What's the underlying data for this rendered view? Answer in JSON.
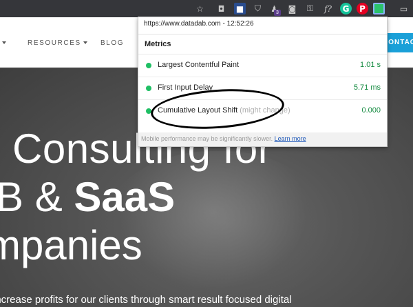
{
  "browser": {
    "extensions": [
      {
        "icon": "star-icon",
        "glyph": "☆"
      },
      {
        "icon": "pocket-icon",
        "glyph": "◘"
      },
      {
        "icon": "adblock-icon",
        "glyph": "■"
      },
      {
        "icon": "shield-icon",
        "glyph": "⛉"
      },
      {
        "icon": "puzzle-icon",
        "glyph": "♟"
      },
      {
        "icon": "camera-icon",
        "glyph": "◙"
      },
      {
        "icon": "lock-icon",
        "glyph": "⚿"
      },
      {
        "icon": "font-icon",
        "glyph": "f?"
      },
      {
        "icon": "grammarly-icon",
        "glyph": "G"
      },
      {
        "icon": "pinterest-icon",
        "glyph": "P"
      },
      {
        "icon": "web-vitals-icon",
        "glyph": ""
      },
      {
        "icon": "cast-icon",
        "glyph": "▭"
      }
    ],
    "badge": "3",
    "colors": {
      "toolbar": "#35363a",
      "grammarly": "#15c39a",
      "pinterest": "#e60023",
      "vitals": "#2bc26b"
    }
  },
  "site": {
    "nav": {
      "items": [
        {
          "label": "",
          "has_arrow": true
        },
        {
          "label": "RESOURCES",
          "has_arrow": true
        },
        {
          "label": "BLOG",
          "has_arrow": false
        }
      ],
      "contact_label": "CONTACT"
    },
    "hero": {
      "line1": "Consulting for",
      "line2_prefix": "B & ",
      "line2_bold": "SaaS",
      "line3": "mpanies",
      "subtitle": "increase profits for our clients through smart result focused digital"
    }
  },
  "popup": {
    "url_time": "https://www.datadab.com - 12:52:26",
    "title": "Metrics",
    "metrics": [
      {
        "name": "Largest Contentful Paint",
        "note": "",
        "value": "1.01 s",
        "status": "good"
      },
      {
        "name": "First Input Delay",
        "note": "",
        "value": "5.71 ms",
        "status": "good"
      },
      {
        "name": "Cumulative Layout Shift",
        "note": "(might change)",
        "value": "0.000",
        "status": "good"
      }
    ],
    "footer_text": "Mobile performance may be significantly slower.",
    "footer_link": "Learn more",
    "colors": {
      "good_dot": "#1fbf64",
      "good_value": "#138a3f",
      "link": "#1a55b8"
    }
  }
}
